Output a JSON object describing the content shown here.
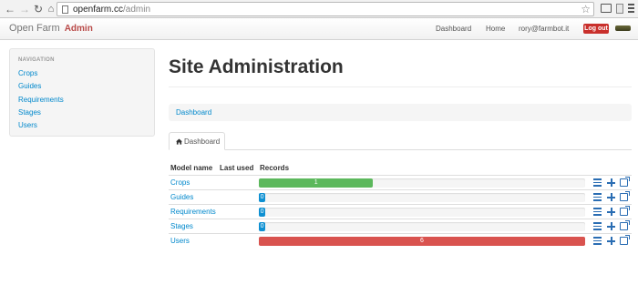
{
  "browser": {
    "url_host": "openfarm.cc",
    "url_path": "/admin"
  },
  "navbar": {
    "brand": "Open Farm",
    "brand_suffix": "Admin",
    "links": [
      "Dashboard",
      "Home",
      "rory@farmbot.it"
    ],
    "logout_label": "Log out"
  },
  "sidebar": {
    "header": "NAVIGATION",
    "items": [
      "Crops",
      "Guides",
      "Requirements",
      "Stages",
      "Users"
    ]
  },
  "main": {
    "title": "Site Administration",
    "breadcrumb": "Dashboard",
    "tab_label": "Dashboard",
    "table": {
      "headers": [
        "Model name",
        "Last used",
        "Records"
      ],
      "rows": [
        {
          "model": "Crops",
          "records": "1",
          "fill": 0.35,
          "color": "#5cb85c"
        },
        {
          "model": "Guides",
          "records": "0",
          "fill": 0.02,
          "color": "#0e90d2"
        },
        {
          "model": "Requirements",
          "records": "0",
          "fill": 0.02,
          "color": "#0e90d2"
        },
        {
          "model": "Stages",
          "records": "0",
          "fill": 0.02,
          "color": "#0e90d2"
        },
        {
          "model": "Users",
          "records": "6",
          "fill": 1.0,
          "color": "#d9534f"
        }
      ]
    }
  },
  "colors": {
    "link": "#0088cc",
    "danger": "#c9302c",
    "success": "#5cb85c",
    "info": "#0e90d2"
  }
}
